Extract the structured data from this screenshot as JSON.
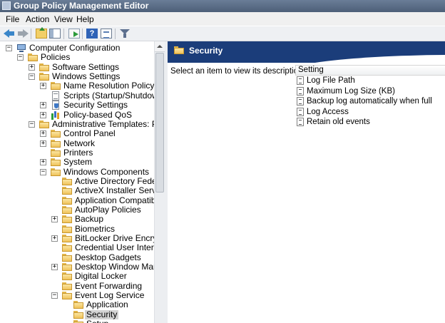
{
  "window": {
    "title": "Group Policy Management Editor"
  },
  "menu": [
    "File",
    "Action",
    "View",
    "Help"
  ],
  "toolbar": {
    "icons": [
      "back-arrow-icon",
      "forward-arrow-icon",
      "up-folder-icon",
      "show-hide-tree-icon",
      "export-list-icon",
      "help-icon",
      "properties-icon",
      "filter-icon"
    ],
    "help_glyph": "?"
  },
  "tree": [
    {
      "label": "Computer Configuration",
      "toggle": "−",
      "icon": "computer-icon"
    },
    {
      "label": "Policies",
      "toggle": "−",
      "icon": "folder-icon"
    },
    {
      "label": "Software Settings",
      "toggle": "+",
      "icon": "folder-icon"
    },
    {
      "label": "Windows Settings",
      "toggle": "−",
      "icon": "folder-icon"
    },
    {
      "label": "Name Resolution Policy",
      "toggle": "+",
      "icon": "folder-icon"
    },
    {
      "label": "Scripts (Startup/Shutdown)",
      "toggle": "",
      "icon": "script-icon"
    },
    {
      "label": "Security Settings",
      "toggle": "+",
      "icon": "shield-icon"
    },
    {
      "label": "Policy-based QoS",
      "toggle": "+",
      "icon": "chart-icon"
    },
    {
      "label": "Administrative Templates: Policy defi",
      "toggle": "−",
      "icon": "folder-icon"
    },
    {
      "label": "Control Panel",
      "toggle": "+",
      "icon": "folder-icon"
    },
    {
      "label": "Network",
      "toggle": "+",
      "icon": "folder-icon"
    },
    {
      "label": "Printers",
      "toggle": "",
      "icon": "folder-icon"
    },
    {
      "label": "System",
      "toggle": "+",
      "icon": "folder-icon"
    },
    {
      "label": "Windows Components",
      "toggle": "−",
      "icon": "folder-icon"
    },
    {
      "label": "Active Directory Federation S",
      "toggle": "",
      "icon": "folder-icon"
    },
    {
      "label": "ActiveX Installer Service",
      "toggle": "",
      "icon": "folder-icon"
    },
    {
      "label": "Application Compatibility",
      "toggle": "",
      "icon": "folder-icon"
    },
    {
      "label": "AutoPlay Policies",
      "toggle": "",
      "icon": "folder-icon"
    },
    {
      "label": "Backup",
      "toggle": "+",
      "icon": "folder-icon"
    },
    {
      "label": "Biometrics",
      "toggle": "",
      "icon": "folder-icon"
    },
    {
      "label": "BitLocker Drive Encryption",
      "toggle": "+",
      "icon": "folder-icon"
    },
    {
      "label": "Credential User Interface",
      "toggle": "",
      "icon": "folder-icon"
    },
    {
      "label": "Desktop Gadgets",
      "toggle": "",
      "icon": "folder-icon"
    },
    {
      "label": "Desktop Window Manager",
      "toggle": "+",
      "icon": "folder-icon"
    },
    {
      "label": "Digital Locker",
      "toggle": "",
      "icon": "folder-icon"
    },
    {
      "label": "Event Forwarding",
      "toggle": "",
      "icon": "folder-icon"
    },
    {
      "label": "Event Log Service",
      "toggle": "−",
      "icon": "folder-icon"
    },
    {
      "label": "Application",
      "toggle": "",
      "icon": "folder-icon"
    },
    {
      "label": "Security",
      "toggle": "",
      "icon": "folder-icon",
      "selected": true
    },
    {
      "label": "Setup",
      "toggle": "",
      "icon": "folder-icon"
    }
  ],
  "details": {
    "title": "Security",
    "description": "Select an item to view its description.",
    "column_header": "Setting",
    "settings": [
      "Log File Path",
      "Maximum Log Size (KB)",
      "Backup log automatically when full",
      "Log Access",
      "Retain old events"
    ]
  },
  "colors": {
    "header_band": "#1b3d7a",
    "title_bar": "#5a6d88",
    "selection": "#d3d3d3"
  }
}
